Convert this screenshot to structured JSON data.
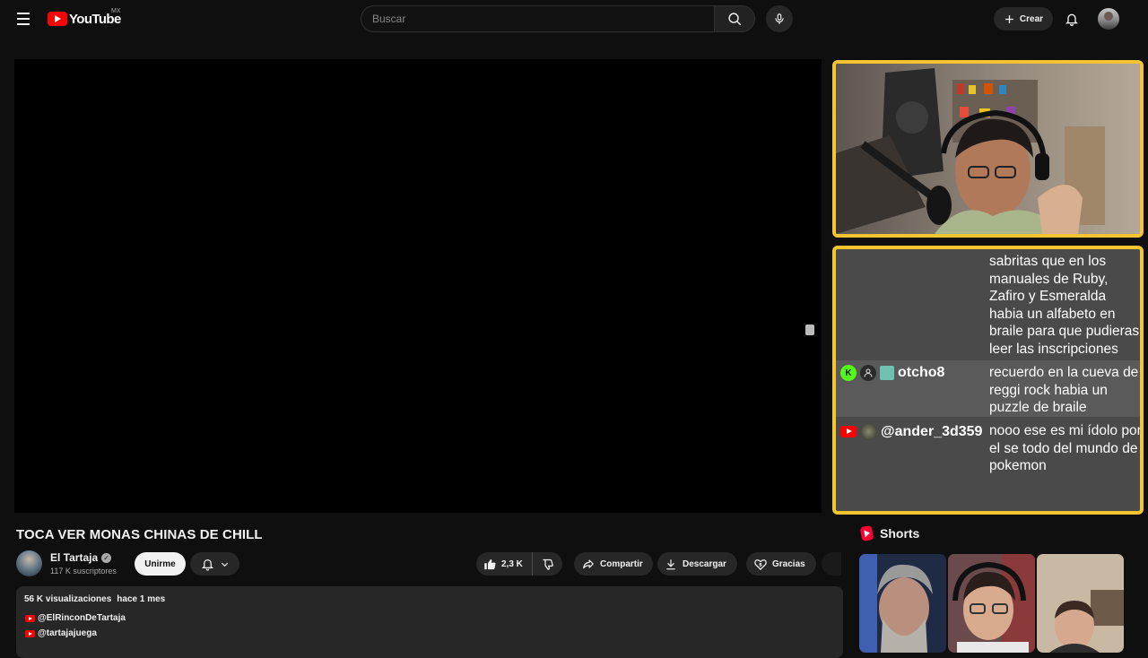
{
  "header": {
    "logo_text": "YouTube",
    "country_code": "MX",
    "search_placeholder": "Buscar",
    "create_label": "Crear"
  },
  "chat": {
    "messages": [
      {
        "author": "",
        "text": "sabritas que en los manuales de Ruby, Zafiro y Esmeralda habia un alfabeto en braile para que pudieras leer las inscripciones"
      },
      {
        "author": "otcho8",
        "badge": "K",
        "text": "recuerdo en la cueva de reggi rock habia un puzzle de braile"
      },
      {
        "author": "@ander_3d359",
        "text": "nooo ese es mi ídolo por el se todo del mundo de pokemon"
      }
    ]
  },
  "video": {
    "title": "TOCA VER MONAS CHINAS DE CHILL",
    "channel_name": "El Tartaja",
    "subscribers": "117 K suscriptores",
    "join_label": "Unirme",
    "like_count": "2,3 K",
    "share_label": "Compartir",
    "download_label": "Descargar",
    "thanks_label": "Gracias"
  },
  "description": {
    "views": "56 K visualizaciones",
    "date": "hace 1 mes",
    "links": [
      "@ElRinconDeTartaja",
      "@tartajajuega"
    ]
  },
  "shorts": {
    "title": "Shorts"
  },
  "colors": {
    "overlay_border": "#f5c431",
    "brand_red": "#ff0000",
    "background": "#0f0f0f"
  }
}
